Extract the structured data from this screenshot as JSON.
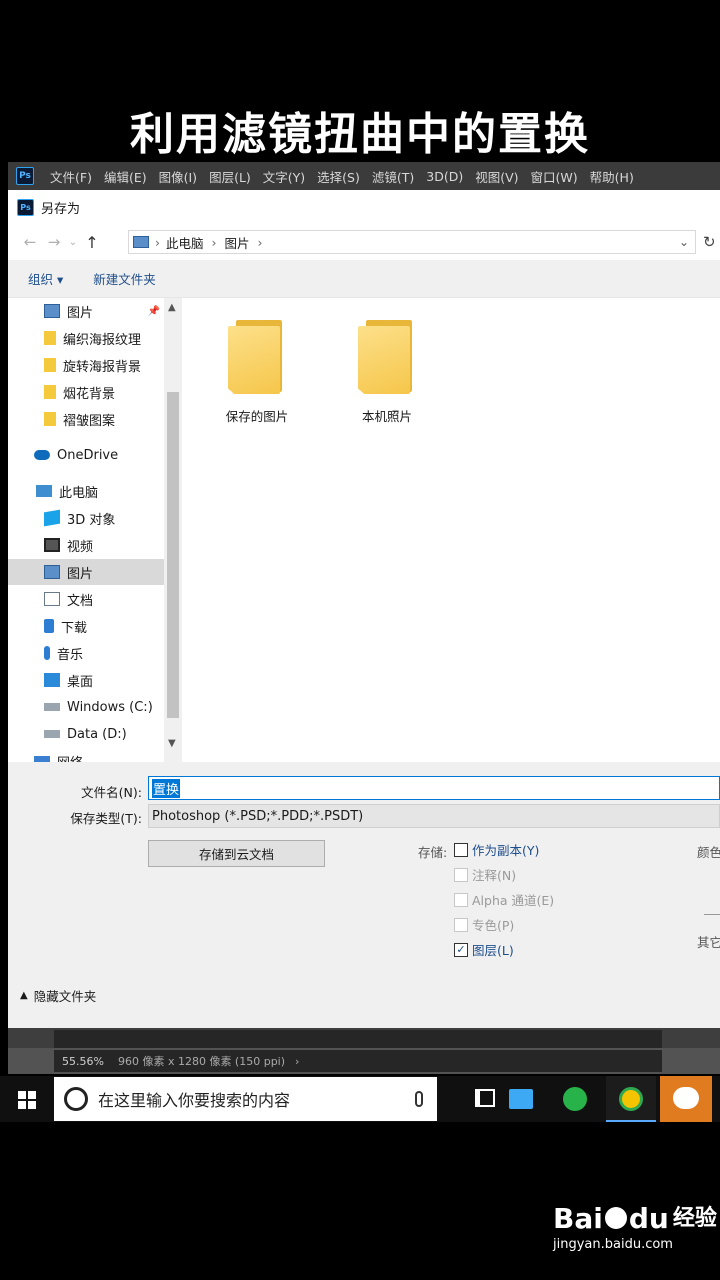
{
  "caption": "利用滤镜扭曲中的置换",
  "menubar": {
    "logo": "Ps",
    "items": [
      "文件(F)",
      "编辑(E)",
      "图像(I)",
      "图层(L)",
      "文字(Y)",
      "选择(S)",
      "滤镜(T)",
      "3D(D)",
      "视图(V)",
      "窗口(W)",
      "帮助(H)"
    ]
  },
  "dialog": {
    "title": "另存为",
    "breadcrumb": [
      "此电脑",
      "图片"
    ],
    "toolbar": {
      "organize": "组织 ▾",
      "new_folder": "新建文件夹"
    },
    "sidebar": [
      {
        "label": "图片",
        "icon": "pictures-icon"
      },
      {
        "label": "编织海报纹理",
        "icon": "folder-icon"
      },
      {
        "label": "旋转海报背景",
        "icon": "folder-icon"
      },
      {
        "label": "烟花背景",
        "icon": "folder-icon"
      },
      {
        "label": "褶皱图案",
        "icon": "folder-icon"
      },
      {
        "label": "OneDrive",
        "icon": "cloud-icon"
      },
      {
        "label": "此电脑",
        "icon": "computer-icon"
      },
      {
        "label": "3D 对象",
        "icon": "cube-icon"
      },
      {
        "label": "视频",
        "icon": "video-icon"
      },
      {
        "label": "图片",
        "icon": "pictures-icon",
        "selected": true
      },
      {
        "label": "文档",
        "icon": "document-icon"
      },
      {
        "label": "下载",
        "icon": "download-icon"
      },
      {
        "label": "音乐",
        "icon": "music-icon"
      },
      {
        "label": "桌面",
        "icon": "desktop-icon"
      },
      {
        "label": "Windows (C:)",
        "icon": "drive-icon"
      },
      {
        "label": "Data (D:)",
        "icon": "drive-icon"
      },
      {
        "label": "网络",
        "icon": "network-icon"
      }
    ],
    "folders": [
      "保存的图片",
      "本机照片"
    ],
    "filename_label": "文件名(N):",
    "filename_value": "置换",
    "filetype_label": "保存类型(T):",
    "filetype_value": "Photoshop (*.PSD;*.PDD;*.PSDT)",
    "cloud_button": "存储到云文档",
    "save_label": "存储:",
    "options": [
      {
        "label": "作为副本(Y)",
        "checked": false,
        "enabled": true
      },
      {
        "label": "注释(N)",
        "checked": false,
        "enabled": false
      },
      {
        "label": "Alpha 通道(E)",
        "checked": false,
        "enabled": false
      },
      {
        "label": "专色(P)",
        "checked": false,
        "enabled": false
      },
      {
        "label": "图层(L)",
        "checked": true,
        "enabled": true
      }
    ],
    "right_labels": [
      "颜色",
      "其它"
    ],
    "hide_folders": "隐藏文件夹"
  },
  "status": {
    "ruler": "0",
    "zoom": "55.56%",
    "info": "960 像素 x 1280 像素 (150 ppi)"
  },
  "taskbar": {
    "search_placeholder": "在这里输入你要搜索的内容"
  },
  "watermark": {
    "brand": "Bai",
    "brand2": "du",
    "cn": "经验",
    "url": "jingyan.baidu.com"
  },
  "colors": {
    "accent": "#1e4e8c",
    "folder": "#f5c64a",
    "selection": "#cce8ff"
  }
}
